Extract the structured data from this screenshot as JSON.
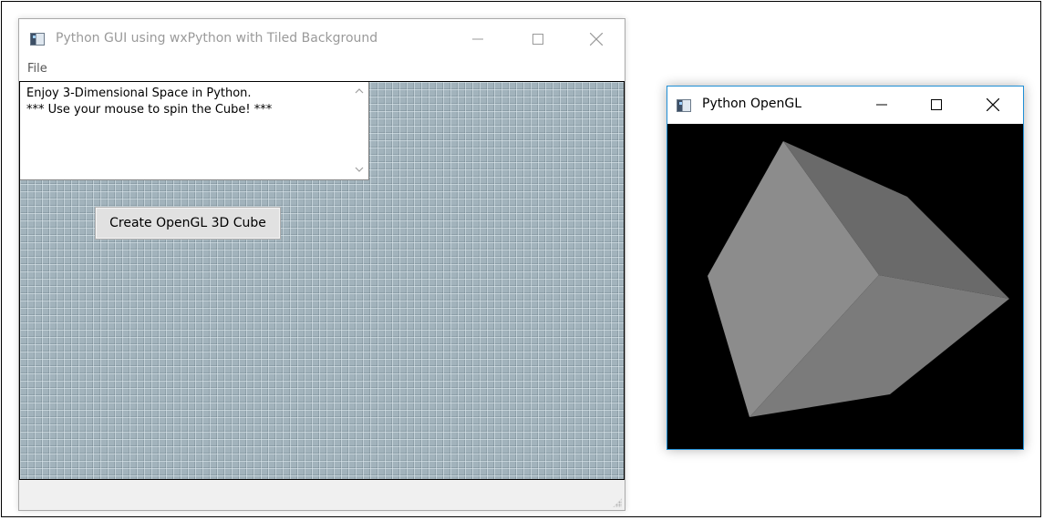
{
  "main_window": {
    "title": "Python GUI using wxPython with Tiled Background",
    "icon": "wx-app-icon",
    "controls": [
      "minimize-icon",
      "maximize-icon",
      "close-icon"
    ],
    "menu": {
      "items": [
        {
          "label": "File"
        }
      ]
    },
    "textarea": {
      "lines": [
        "Enjoy 3-Dimensional Space in Python.",
        "*** Use your mouse to spin the Cube! ***"
      ]
    },
    "button": {
      "label": "Create OpenGL 3D Cube"
    },
    "colors": {
      "tile_background": "#a2b3bc"
    }
  },
  "gl_window": {
    "title": "Python OpenGL",
    "icon": "wx-app-icon",
    "controls": [
      "minimize-icon",
      "maximize-icon",
      "close-icon"
    ],
    "canvas": {
      "content": "cube",
      "colors": {
        "background": "#000000",
        "face_light": "#8c8c8c",
        "face_mid": "#7b7b7b",
        "face_dark": "#6a6a6a"
      }
    },
    "colors": {
      "border_accent": "#1f8fd6"
    }
  }
}
